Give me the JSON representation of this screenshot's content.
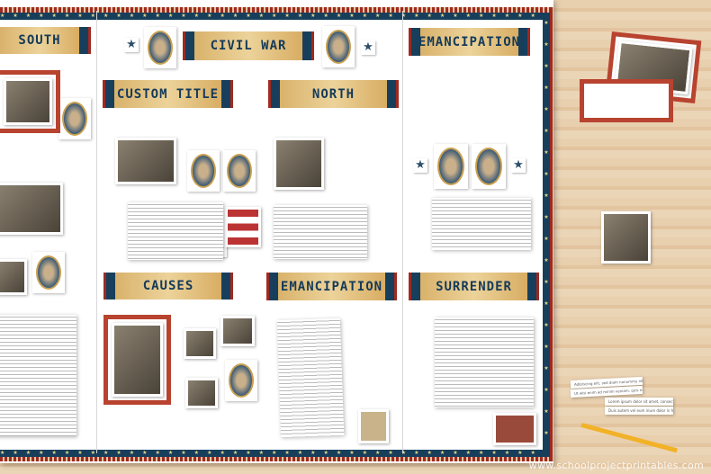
{
  "titles": {
    "south": "SOUTH",
    "civil_war": "CIVIL WAR",
    "custom_title": "CUSTOM TITLE",
    "north": "NORTH",
    "emancipation_top": "EMANCIPATION",
    "causes": "CAUSES",
    "emancipation_mid": "EMANCIPATION",
    "surrender": "SURRENDER"
  },
  "strips": {
    "right_1": "Adipiscing elit, sed diam nonummy nibh euismod.",
    "right_2": "Ut wisi enim ad minim veniam, quis nostrud.",
    "right_3": "Lorem ipsum dolor sit amet, consectetuer adipiscing.",
    "right_4": "Duis autem vel eum iriure dolor in hendrerit."
  },
  "stars": {
    "glyph": "★"
  },
  "colors": {
    "navy": "#173f5c",
    "red": "#9e2a22",
    "parchment": "#e6c788"
  },
  "watermark": "www.schoolprojectprintables.com"
}
